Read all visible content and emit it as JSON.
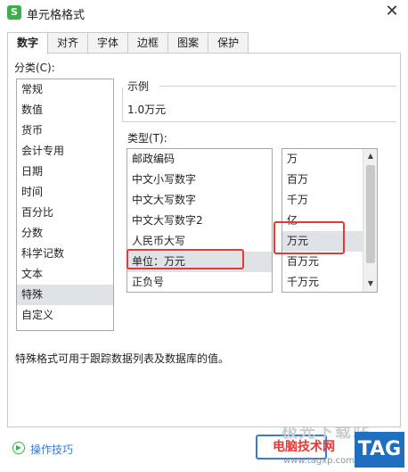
{
  "window": {
    "title": "单元格格式",
    "app_icon_letter": "S",
    "close_glyph": "✕"
  },
  "tabs": [
    {
      "label": "数字",
      "active": true
    },
    {
      "label": "对齐"
    },
    {
      "label": "字体"
    },
    {
      "label": "边框"
    },
    {
      "label": "图案"
    },
    {
      "label": "保护"
    }
  ],
  "category": {
    "label": "分类(C):",
    "items": [
      "常规",
      "数值",
      "货币",
      "会计专用",
      "日期",
      "时间",
      "百分比",
      "分数",
      "科学记数",
      "文本",
      "特殊",
      "自定义"
    ],
    "selected_index": 10
  },
  "sample": {
    "label": "示例",
    "value": "1.0万元"
  },
  "type": {
    "label": "类型(T):",
    "items": [
      "邮政编码",
      "中文小写数字",
      "中文大写数字",
      "中文大写数字2",
      "人民币大写",
      "单位：万元",
      "正负号"
    ],
    "selected_index": 5
  },
  "unit": {
    "items": [
      "万",
      "百万",
      "千万",
      "亿",
      "万元",
      "百万元",
      "千万元"
    ],
    "selected_index": 4
  },
  "description": "特殊格式可用于跟踪数据列表及数据库的值。",
  "footer": {
    "tips_label": "操作技巧"
  },
  "watermark": {
    "line1": "极光下载站",
    "line2": "电脑技术网",
    "line3": "www.tagxp.com",
    "tag": "TAG"
  },
  "colors": {
    "highlight_box": "#e53935",
    "accent": "#3a7bd5",
    "selected_bg": "#dfe3e8"
  }
}
